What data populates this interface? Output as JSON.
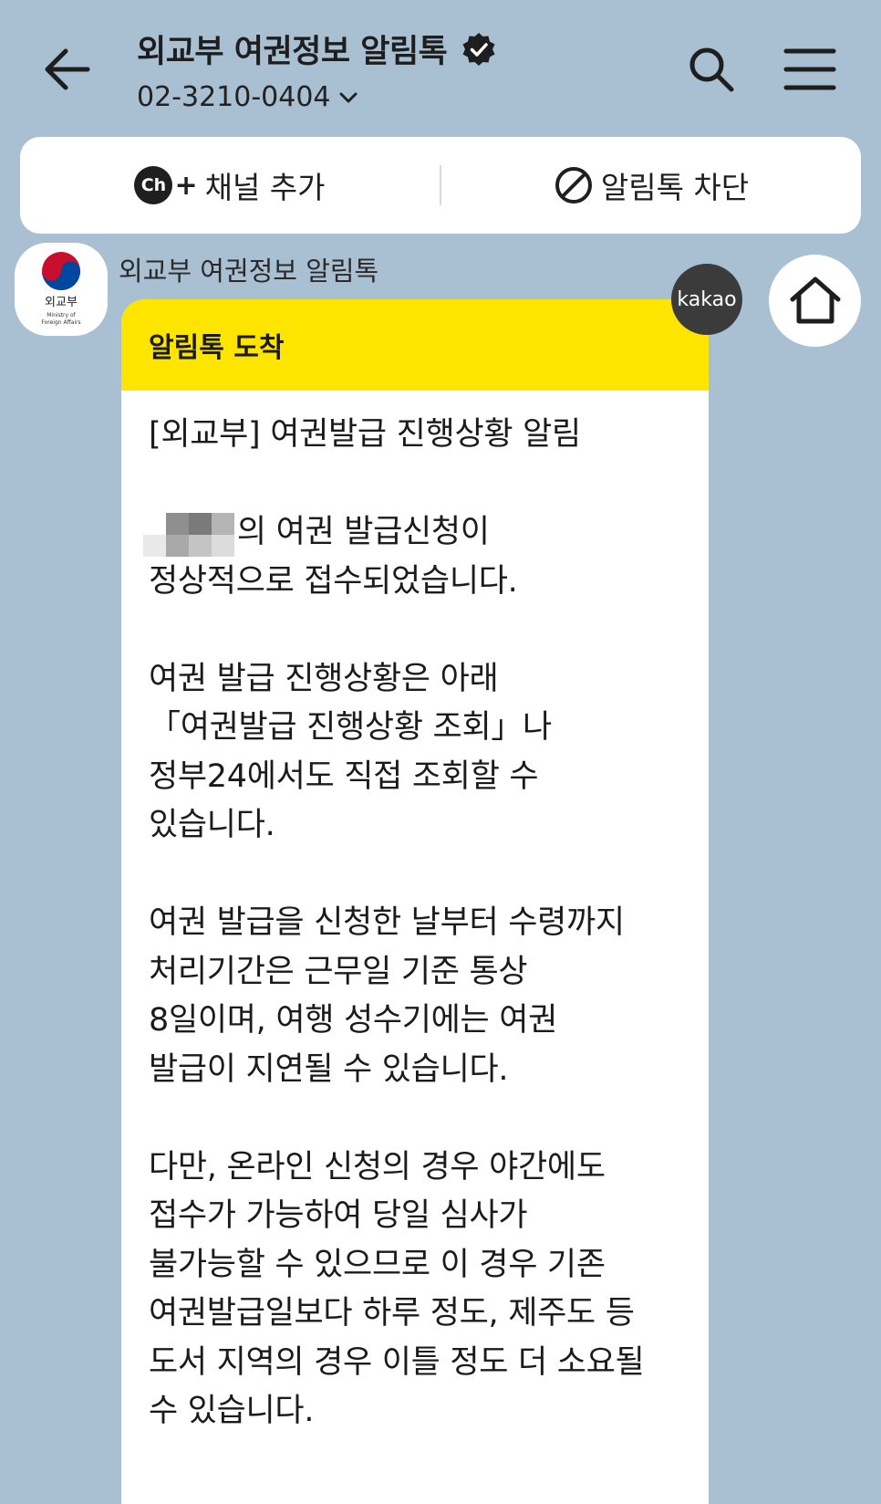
{
  "header": {
    "title": "외교부 여권정보 알림톡",
    "phone": "02-3210-0404"
  },
  "actions": {
    "add_channel": "채널 추가",
    "block_alimtalk": "알림톡 차단",
    "ch_badge": "Ch"
  },
  "message": {
    "sender": "외교부 여권정보 알림톡",
    "avatar_label": "외교부",
    "avatar_sub1": "Ministry of",
    "avatar_sub2": "Foreign Affairs",
    "header": "알림톡 도착",
    "body": "[외교부] 여권발급 진행상황 알림\n\n      님의 여권 발급신청이\n정상적으로 접수되었습니다.\n\n여권 발급 진행상황은 아래\n「여권발급 진행상황 조회」나\n정부24에서도 직접 조회할 수\n있습니다.\n\n여권 발급을 신청한 날부터 수령까지\n처리기간은 근무일 기준 통상\n8일이며, 여행 성수기에는 여권\n발급이 지연될 수 있습니다.\n\n다만, 온라인 신청의 경우 야간에도\n접수가 가능하여 당일 심사가\n불가능할 수 있으므로 이 경우 기존\n여권발급일보다 하루 정도, 제주도 등\n도서 지역의 경우 이틀 정도 더 소요될\n수 있습니다."
  },
  "floating": {
    "kakao": "kakao"
  },
  "colors": {
    "background": "#a9bfd2",
    "bubble_header": "#fde500"
  }
}
